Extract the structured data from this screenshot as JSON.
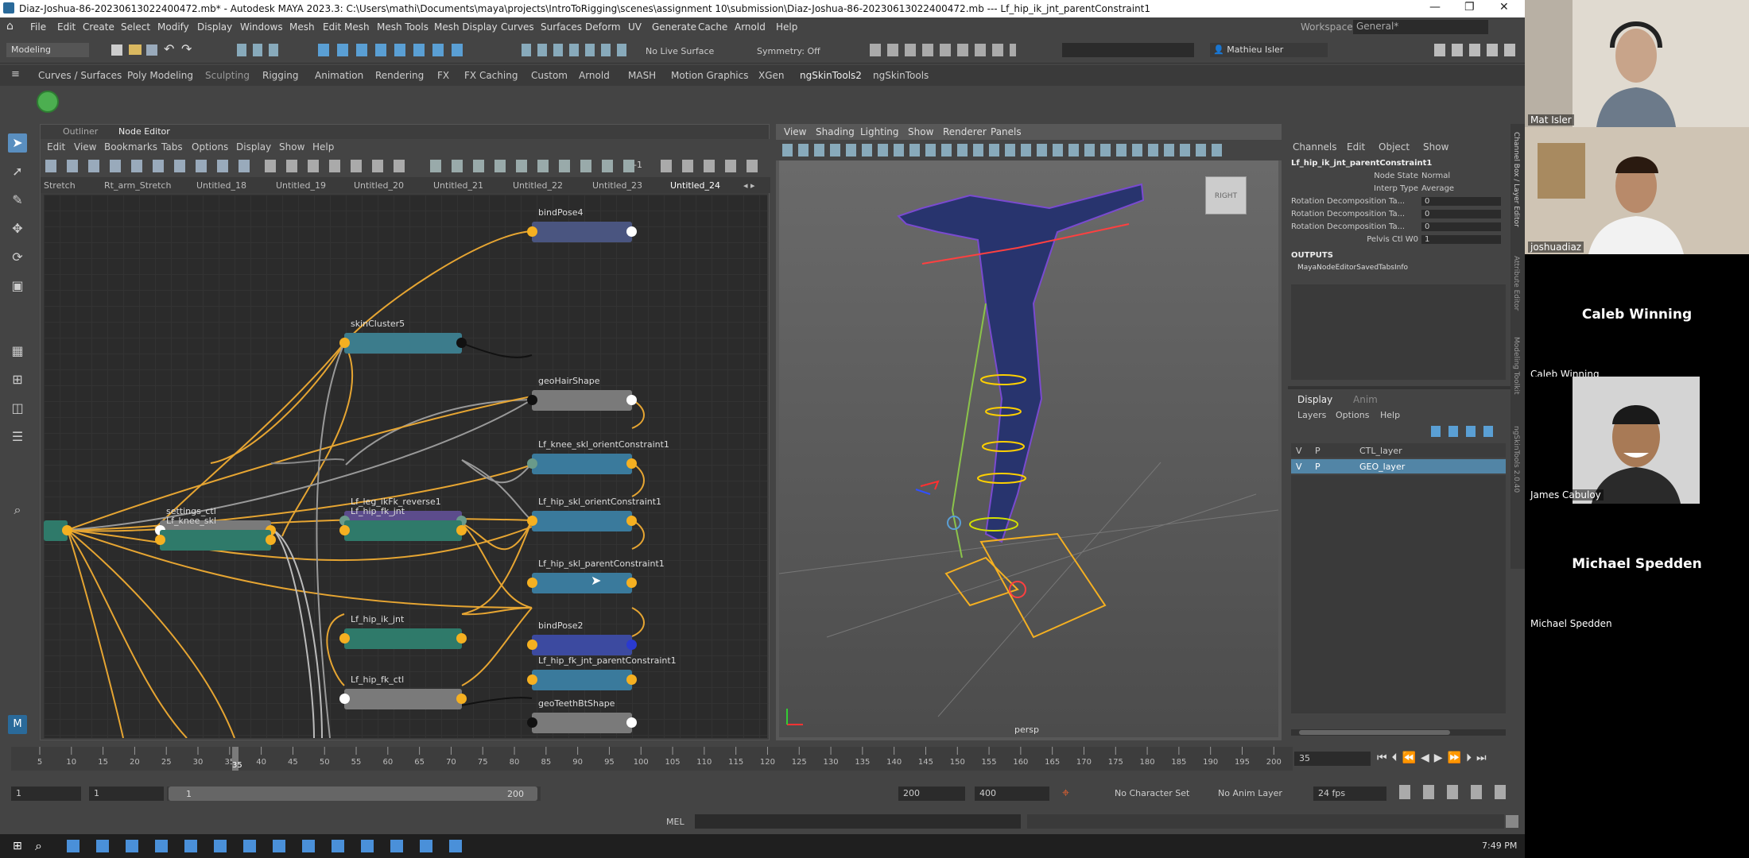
{
  "window": {
    "title": "Diaz-Joshua-86-20230613022400472.mb* - Autodesk MAYA 2023.3: C:\\Users\\mathi\\Documents\\maya\\projects\\IntroToRigging\\scenes\\assignment 10\\submission\\Diaz-Joshua-86-20230613022400472.mb  ---  Lf_hip_ik_jnt_parentConstraint1",
    "minimize": "—",
    "restore": "❐",
    "close": "✕"
  },
  "menubar": {
    "items": [
      "File",
      "Edit",
      "Create",
      "Select",
      "Modify",
      "Display",
      "Windows",
      "Mesh",
      "Edit Mesh",
      "Mesh Tools",
      "Mesh Display",
      "Curves",
      "Surfaces",
      "Deform",
      "UV",
      "Generate",
      "Cache",
      "Arnold",
      "Help"
    ],
    "workspace_label": "Workspace:",
    "workspace_value": "General*"
  },
  "statusline": {
    "mode": "Modeling",
    "live_surface": "No Live Surface",
    "symmetry": "Symmetry: Off",
    "user": "Mathieu Isler"
  },
  "shelf": {
    "tabs": [
      "Curves / Surfaces",
      "Poly Modeling",
      "Sculpting",
      "Rigging",
      "Animation",
      "Rendering",
      "FX",
      "FX Caching",
      "Custom",
      "Arnold",
      "MASH",
      "Motion Graphics",
      "XGen",
      "ngSkinTools2",
      "ngSkinTools"
    ]
  },
  "node_editor": {
    "panel_tabs": [
      "Outliner",
      "Node Editor"
    ],
    "menu": [
      "Edit",
      "View",
      "Bookmarks",
      "Tabs",
      "Options",
      "Display",
      "Show",
      "Help"
    ],
    "toolbar_value": "-1",
    "graph_tabs": [
      "Stretch",
      "Rt_arm_Stretch",
      "Untitled_18",
      "Untitled_19",
      "Untitled_20",
      "Untitled_21",
      "Untitled_22",
      "Untitled_23",
      "Untitled_24"
    ],
    "nodes": [
      {
        "label": "bindPose4",
        "color": "#4a5580"
      },
      {
        "label": "skinCluster5",
        "color": "#3c7c8c"
      },
      {
        "label": "geoHairShape",
        "color": "#7a7a7a"
      },
      {
        "label": "Lf_knee_skl_orientConstraint1",
        "color": "#3a7a9c"
      },
      {
        "label": "settings_ctl",
        "color": "#7a7a7a"
      },
      {
        "label": "Lf_leg_ikFk_reverse1",
        "color": "#5c4c8c"
      },
      {
        "label": "Lf_hip_skl_orientConstraint1",
        "color": "#3a7a9c"
      },
      {
        "label": "Lf_hip_skl_parentConstraint1",
        "color": "#3a7a9c"
      },
      {
        "label": "Lf_knee_skl",
        "color": "#2f7a6a"
      },
      {
        "label": "Lf_hip_fk_jnt",
        "color": "#2f7a6a"
      },
      {
        "label": "bindPose2",
        "color": "#3c4aa0"
      },
      {
        "label": "Lf_hip_ik_jnt",
        "color": "#2f7a6a"
      },
      {
        "label": "Lf_hip_fk_jnt_parentConstraint1",
        "color": "#3a7a9c"
      },
      {
        "label": "Lf_hip_fk_ctl",
        "color": "#7a7a7a"
      },
      {
        "label": "geoTeethBtShape",
        "color": "#7a7a7a"
      }
    ]
  },
  "viewport": {
    "menu": [
      "View",
      "Shading",
      "Lighting",
      "Show",
      "Renderer",
      "Panels"
    ],
    "camera": "persp",
    "cube_label": "RIGHT"
  },
  "channel_box": {
    "menu": [
      "Channels",
      "Edit",
      "Object",
      "Show"
    ],
    "node_name": "Lf_hip_ik_jnt_parentConstraint1",
    "attrs": [
      {
        "name": "Node State",
        "value": "Normal"
      },
      {
        "name": "Interp Type",
        "value": "Average"
      },
      {
        "name": "Rotation Decomposition Ta...",
        "value": "0"
      },
      {
        "name": "Rotation Decomposition Ta...",
        "value": "0"
      },
      {
        "name": "Rotation Decomposition Ta...",
        "value": "0"
      },
      {
        "name": "Pelvis Ctl W0",
        "value": "1"
      }
    ],
    "outputs_label": "OUTPUTS",
    "output_item": "MayaNodeEditorSavedTabsInfo",
    "side_tabs": [
      "Channel Box / Layer Editor",
      "Attribute Editor",
      "Modeling Toolkit",
      "ngSkinTools 2.0.40"
    ]
  },
  "layer_editor": {
    "tabs": [
      "Display",
      "Anim"
    ],
    "menu": [
      "Layers",
      "Options",
      "Help"
    ],
    "layers": [
      {
        "v": "V",
        "p": "P",
        "name": "CTL_layer"
      },
      {
        "v": "V",
        "p": "P",
        "name": "GEO_layer"
      }
    ]
  },
  "timeline": {
    "ticks": [
      "5",
      "10",
      "15",
      "20",
      "25",
      "30",
      "35",
      "40",
      "45",
      "50",
      "55",
      "60",
      "65",
      "70",
      "75",
      "80",
      "85",
      "90",
      "95",
      "100",
      "105",
      "110",
      "115",
      "120",
      "125",
      "130",
      "135",
      "140",
      "145",
      "150",
      "155",
      "160",
      "165",
      "170",
      "175",
      "180",
      "185",
      "190",
      "195",
      "200"
    ],
    "current_frame": "35"
  },
  "range": {
    "start": "1",
    "start2": "1",
    "range_start": "1",
    "range_end": "200",
    "end": "200",
    "end2": "400",
    "char_set": "No Character Set",
    "anim_layer": "No Anim Layer",
    "fps": "24 fps"
  },
  "cmd": {
    "lang": "MEL"
  },
  "taskbar": {
    "time": "7:49 PM"
  },
  "participants": [
    {
      "name": "Mat Isler",
      "has_video": true,
      "skin": "#c8a48a",
      "bg": "#d8d2c8"
    },
    {
      "name": "joshuadiaz",
      "has_video": true,
      "skin": "#b88a6a",
      "bg": "#cbbfae"
    },
    {
      "name": "Caleb Winning",
      "has_video": false
    },
    {
      "name": "James Cabuloy",
      "has_video": true,
      "skin": "#a87a56",
      "bg": "#d0d0d0"
    },
    {
      "name": "Michael Spedden",
      "has_video": false
    }
  ]
}
